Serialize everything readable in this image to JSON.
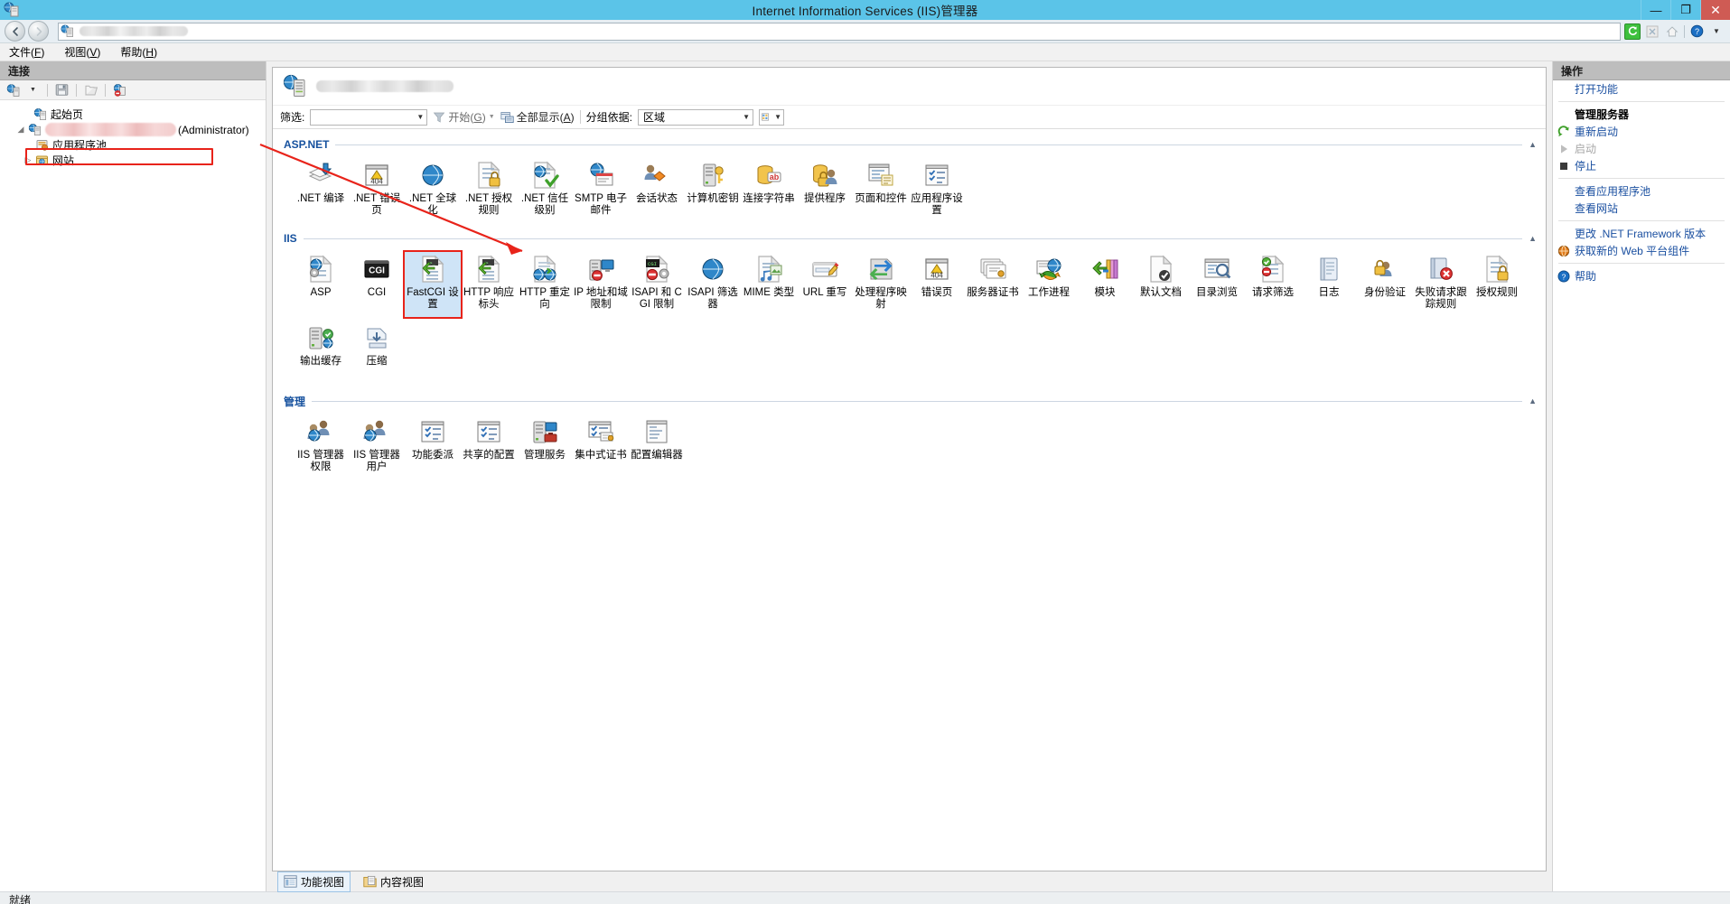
{
  "window": {
    "title": "Internet Information Services (IIS)管理器",
    "app_icon": "iis-server-icon",
    "controls": {
      "minimize": "—",
      "maximize": "❐",
      "close": "✕"
    },
    "accent_titlebar": "#5bc4e8",
    "close_color": "#cf5b54"
  },
  "addressbar": {
    "back_icon": "back-arrow-icon",
    "forward_icon": "forward-arrow-icon",
    "path_icon": "server-icon",
    "path_value": "",
    "right_icons": [
      "refresh-icon",
      "stop-icon",
      "home-icon",
      "help-icon",
      "dropdown-icon"
    ]
  },
  "menubar": {
    "items": [
      {
        "label": "文件",
        "accel": "F"
      },
      {
        "label": "视图",
        "accel": "V"
      },
      {
        "label": "帮助",
        "accel": "H"
      }
    ]
  },
  "connections": {
    "header": "连接",
    "toolbar_icons": [
      "connect-to-server-icon",
      "dropdown-icon",
      "save-icon",
      "separator",
      "export-icon",
      "separator",
      "disconnect-icon"
    ],
    "tree": [
      {
        "label": "起始页",
        "icon": "start-page-icon",
        "twisty": "",
        "indent": 1
      },
      {
        "label": "(Administrator)",
        "icon": "server-icon",
        "twisty": "▲",
        "indent": 0,
        "redacted": true,
        "highlighted": true
      },
      {
        "label": "应用程序池",
        "icon": "app-pools-icon",
        "twisty": "",
        "indent": 2
      },
      {
        "label": "网站",
        "icon": "sites-icon",
        "twisty": "▷",
        "indent": 2
      }
    ]
  },
  "feature_view": {
    "page_icon": "server-icon",
    "page_title_redacted": true,
    "filter": {
      "label": "筛选:",
      "value": "",
      "go_label": "开始",
      "go_accel": "G",
      "go_icon": "filter-funnel-icon",
      "showall_label": "全部显示",
      "showall_accel": "A",
      "showall_icon": "show-all-icon",
      "groupby_label": "分组依据:",
      "groupby_value": "区域",
      "viewmode_icon": "view-icons-icon"
    },
    "groups": [
      {
        "title": "ASP.NET",
        "collapse_icon": "chevron-up-icon",
        "items": [
          {
            "label": ".NET 编译",
            "icon": "net-compilation-icon"
          },
          {
            "label": ".NET 错误页",
            "icon": "net-error-pages-icon"
          },
          {
            "label": ".NET 全球化",
            "icon": "net-globalization-icon"
          },
          {
            "label": ".NET 授权规则",
            "icon": "net-authorization-rules-icon"
          },
          {
            "label": ".NET 信任级别",
            "icon": "net-trust-levels-icon"
          },
          {
            "label": "SMTP 电子邮件",
            "icon": "smtp-email-icon"
          },
          {
            "label": "会话状态",
            "icon": "session-state-icon"
          },
          {
            "label": "计算机密钥",
            "icon": "machine-key-icon"
          },
          {
            "label": "连接字符串",
            "icon": "connection-strings-icon"
          },
          {
            "label": "提供程序",
            "icon": "providers-icon"
          },
          {
            "label": "页面和控件",
            "icon": "pages-and-controls-icon"
          },
          {
            "label": "应用程序设置",
            "icon": "application-settings-icon"
          }
        ]
      },
      {
        "title": "IIS",
        "collapse_icon": "chevron-up-icon",
        "items": [
          {
            "label": "ASP",
            "icon": "asp-icon"
          },
          {
            "label": "CGI",
            "icon": "cgi-icon"
          },
          {
            "label": "FastCGI 设置",
            "icon": "fastcgi-settings-icon",
            "selected": true
          },
          {
            "label": "HTTP 响应标头",
            "icon": "http-response-headers-icon"
          },
          {
            "label": "HTTP 重定向",
            "icon": "http-redirect-icon"
          },
          {
            "label": "IP 地址和域限制",
            "icon": "ip-address-domain-restrictions-icon"
          },
          {
            "label": "ISAPI 和 CGI 限制",
            "icon": "isapi-cgi-restrictions-icon"
          },
          {
            "label": "ISAPI 筛选器",
            "icon": "isapi-filters-icon"
          },
          {
            "label": "MIME 类型",
            "icon": "mime-types-icon"
          },
          {
            "label": "URL 重写",
            "icon": "url-rewrite-icon"
          },
          {
            "label": "处理程序映射",
            "icon": "handler-mappings-icon"
          },
          {
            "label": "错误页",
            "icon": "error-pages-icon"
          },
          {
            "label": "服务器证书",
            "icon": "server-certificates-icon"
          },
          {
            "label": "工作进程",
            "icon": "worker-processes-icon"
          },
          {
            "label": "模块",
            "icon": "modules-icon"
          },
          {
            "label": "默认文档",
            "icon": "default-document-icon"
          },
          {
            "label": "目录浏览",
            "icon": "directory-browsing-icon"
          },
          {
            "label": "请求筛选",
            "icon": "request-filtering-icon"
          },
          {
            "label": "日志",
            "icon": "logging-icon"
          },
          {
            "label": "身份验证",
            "icon": "authentication-icon"
          },
          {
            "label": "失败请求跟踪规则",
            "icon": "failed-request-tracing-rules-icon"
          },
          {
            "label": "授权规则",
            "icon": "authorization-rules-icon"
          },
          {
            "label": "输出缓存",
            "icon": "output-caching-icon"
          },
          {
            "label": "压缩",
            "icon": "compression-icon"
          }
        ]
      },
      {
        "title": "管理",
        "collapse_icon": "chevron-up-icon",
        "items": [
          {
            "label": "IIS 管理器权限",
            "icon": "iis-manager-permissions-icon"
          },
          {
            "label": "IIS 管理器用户",
            "icon": "iis-manager-users-icon"
          },
          {
            "label": "功能委派",
            "icon": "feature-delegation-icon"
          },
          {
            "label": "共享的配置",
            "icon": "shared-configuration-icon"
          },
          {
            "label": "管理服务",
            "icon": "management-service-icon"
          },
          {
            "label": "集中式证书",
            "icon": "centralized-certificates-icon"
          },
          {
            "label": "配置编辑器",
            "icon": "configuration-editor-icon"
          }
        ]
      }
    ],
    "view_tabs": [
      {
        "label": "功能视图",
        "icon": "features-view-icon",
        "active": true
      },
      {
        "label": "内容视图",
        "icon": "content-view-icon",
        "active": false
      }
    ]
  },
  "actions": {
    "header": "操作",
    "items": [
      {
        "label": "打开功能",
        "icon": "",
        "style": "link"
      },
      {
        "separator": true
      },
      {
        "label": "管理服务器",
        "icon": "",
        "style": "bold"
      },
      {
        "label": "重新启动",
        "icon": "restart-icon",
        "style": "link"
      },
      {
        "label": "启动",
        "icon": "start-icon",
        "style": "disabled"
      },
      {
        "label": "停止",
        "icon": "stop-icon",
        "style": "link"
      },
      {
        "separator": true
      },
      {
        "label": "查看应用程序池",
        "icon": "",
        "style": "link"
      },
      {
        "label": "查看网站",
        "icon": "",
        "style": "link"
      },
      {
        "separator": true
      },
      {
        "label": "更改 .NET Framework 版本",
        "icon": "",
        "style": "link"
      },
      {
        "label": "获取新的 Web 平台组件",
        "icon": "web-platform-icon",
        "style": "link"
      },
      {
        "separator": true
      },
      {
        "label": "帮助",
        "icon": "help-icon",
        "style": "link"
      }
    ]
  },
  "statusbar": {
    "text": "就绪"
  },
  "annotation": {
    "color": "#e8231a",
    "description": "red-callout-arrow-from-fastcgi-to-server-node"
  }
}
